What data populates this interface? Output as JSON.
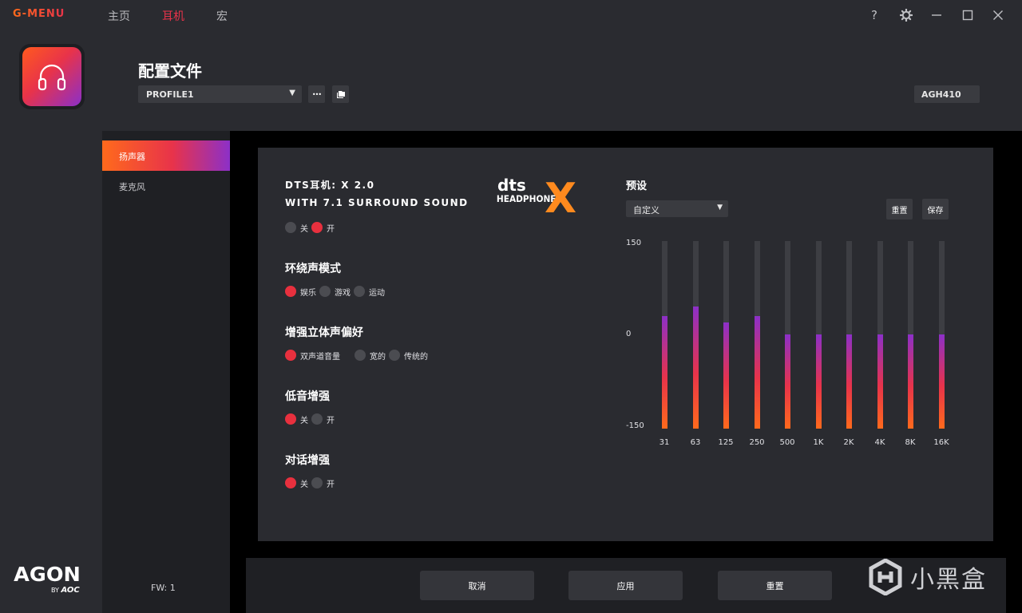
{
  "app": {
    "brand": "G-MENU",
    "nav_tabs": [
      {
        "label": "主页",
        "active": false
      },
      {
        "label": "耳机",
        "active": true
      },
      {
        "label": "宏",
        "active": false
      }
    ],
    "window_buttons": [
      "help-icon",
      "gear-icon",
      "minimize-icon",
      "maximize-icon",
      "close-icon"
    ],
    "help_label": "?"
  },
  "rail": {
    "device_icon": "headphone-icon",
    "logo_main": "AGON",
    "logo_by": "BY",
    "logo_brand": "AOC"
  },
  "header": {
    "title": "配置文件",
    "profile": "PROFILE1",
    "more_label": "•••",
    "model": "AGH410"
  },
  "sidenav": {
    "items": [
      {
        "label": "扬声器",
        "active": true
      },
      {
        "label": "麦克风",
        "active": false
      }
    ],
    "fw": "FW: 1"
  },
  "dts": {
    "title": "DTS耳机: X 2.0",
    "subtitle": "WITH 7.1 SURROUND SOUND",
    "toggle": [
      {
        "label": "关",
        "on": false
      },
      {
        "label": "开",
        "on": true
      }
    ],
    "logo_word": "dts",
    "logo_sub": "HEADPHONE",
    "logo_x": "X"
  },
  "sections": [
    {
      "title": "环绕声模式",
      "options": [
        {
          "label": "娱乐",
          "on": true
        },
        {
          "label": "游戏",
          "on": false
        },
        {
          "label": "运动",
          "on": false
        }
      ]
    },
    {
      "title": "增强立体声偏好",
      "options": [
        {
          "label": "双声道音量",
          "on": true
        },
        {
          "label": "宽的",
          "on": false
        },
        {
          "label": "传统的",
          "on": false
        }
      ]
    },
    {
      "title": "低音增强",
      "options": [
        {
          "label": "关",
          "on": true
        },
        {
          "label": "开",
          "on": false
        }
      ]
    },
    {
      "title": "对话增强",
      "options": [
        {
          "label": "关",
          "on": true
        },
        {
          "label": "开",
          "on": false
        }
      ]
    }
  ],
  "eq": {
    "title": "预设",
    "preset": "自定义",
    "reset_label": "重置",
    "save_label": "保存",
    "y_max": "150",
    "y_mid": "0",
    "y_min": "-150",
    "range": [
      -150,
      150
    ],
    "bands": [
      {
        "label": "31",
        "value": 30
      },
      {
        "label": "63",
        "value": 45
      },
      {
        "label": "125",
        "value": 20
      },
      {
        "label": "250",
        "value": 30
      },
      {
        "label": "500",
        "value": 0
      },
      {
        "label": "1K",
        "value": 0
      },
      {
        "label": "2K",
        "value": 0
      },
      {
        "label": "4K",
        "value": 0
      },
      {
        "label": "8K",
        "value": 0
      },
      {
        "label": "16K",
        "value": 0
      }
    ]
  },
  "footer": {
    "cancel": "取消",
    "apply": "应用",
    "reset": "重置"
  },
  "watermark": {
    "text": "小黑盒"
  },
  "colors": {
    "accent": "#e8334a",
    "orange": "#ff6a1c",
    "purple": "#8c30c8",
    "radio_on": "#e8303e"
  }
}
